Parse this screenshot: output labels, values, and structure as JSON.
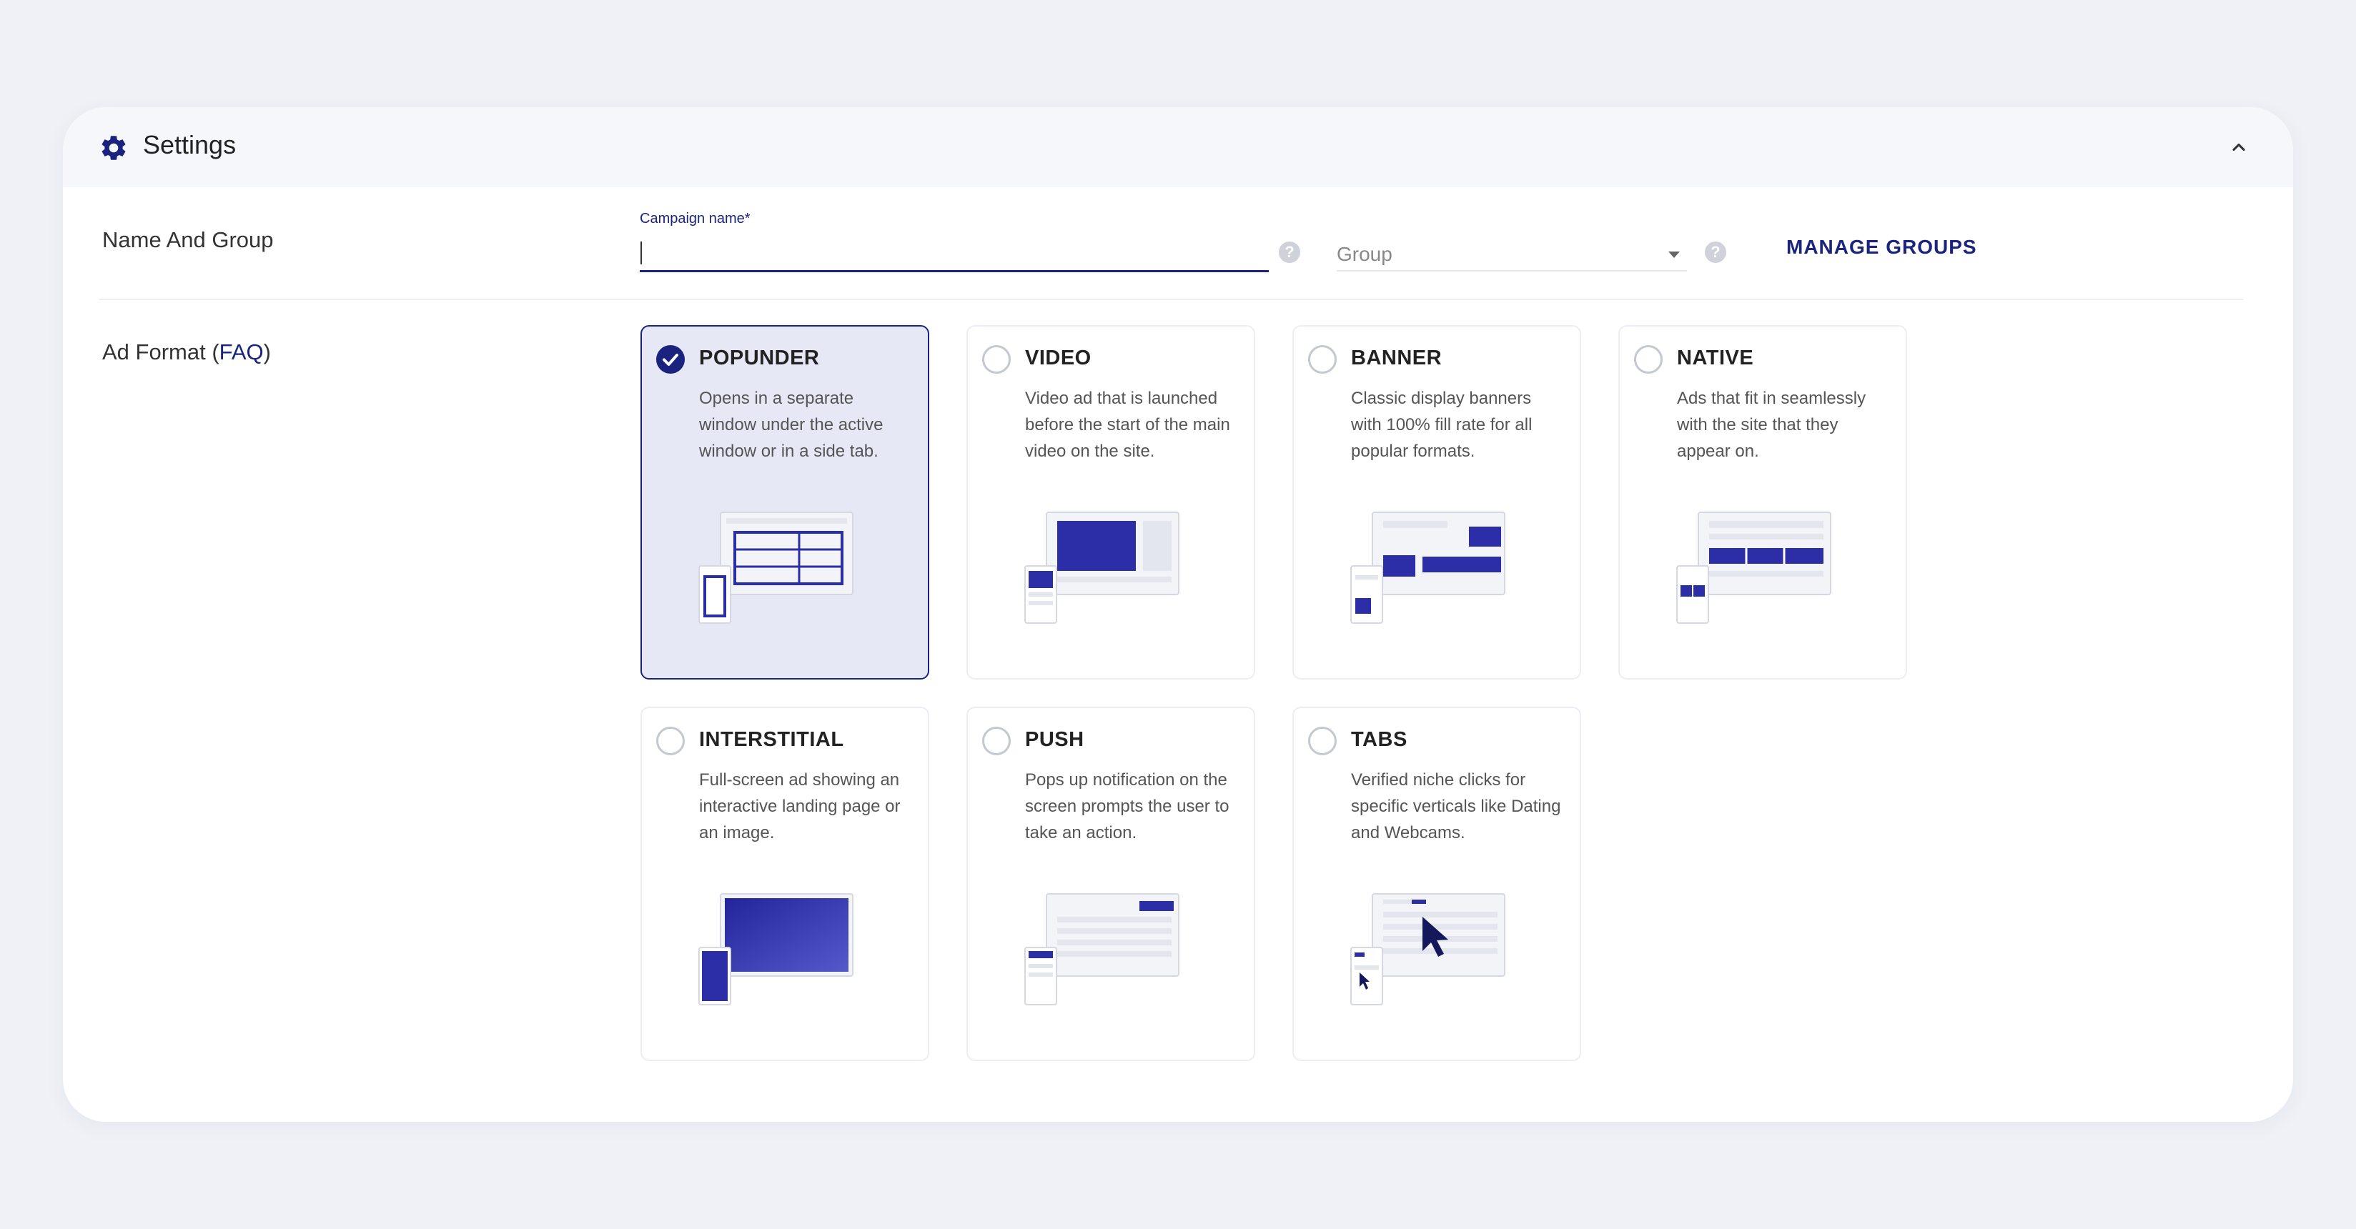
{
  "header": {
    "title": "Settings",
    "icon": "gear-icon",
    "collapse_icon": "chevron-up-icon"
  },
  "name_group": {
    "label": "Name And Group",
    "campaign_label": "Campaign name*",
    "campaign_value": "",
    "group_placeholder": "Group",
    "manage_groups": "MANAGE GROUPS",
    "help_icon": "question-icon"
  },
  "ad_format": {
    "label": "Ad Format (",
    "faq": "FAQ",
    "label_close": ")",
    "selected": "POPUNDER",
    "options": [
      {
        "title": "POPUNDER",
        "desc": "Opens in a separate window under the active window or in a side tab."
      },
      {
        "title": "VIDEO",
        "desc": "Video ad that is launched before the start of the main video on the site."
      },
      {
        "title": "BANNER",
        "desc": "Classic display banners with 100% fill rate for all popular formats."
      },
      {
        "title": "NATIVE",
        "desc": "Ads that fit in seamlessly with the site that they appear on."
      },
      {
        "title": "INTERSTITIAL",
        "desc": "Full-screen ad showing an interactive landing page or an image."
      },
      {
        "title": "PUSH",
        "desc": "Pops up notification on the screen prompts the user to take an action."
      },
      {
        "title": "TABS",
        "desc": "Verified niche clicks for specific verticals like Dating and Webcams."
      }
    ]
  },
  "colors": {
    "accent": "#1a237e",
    "illustration": "#2b2ea6",
    "page_bg": "#eff1f6",
    "selected_card_bg": "#e6e8f6"
  }
}
